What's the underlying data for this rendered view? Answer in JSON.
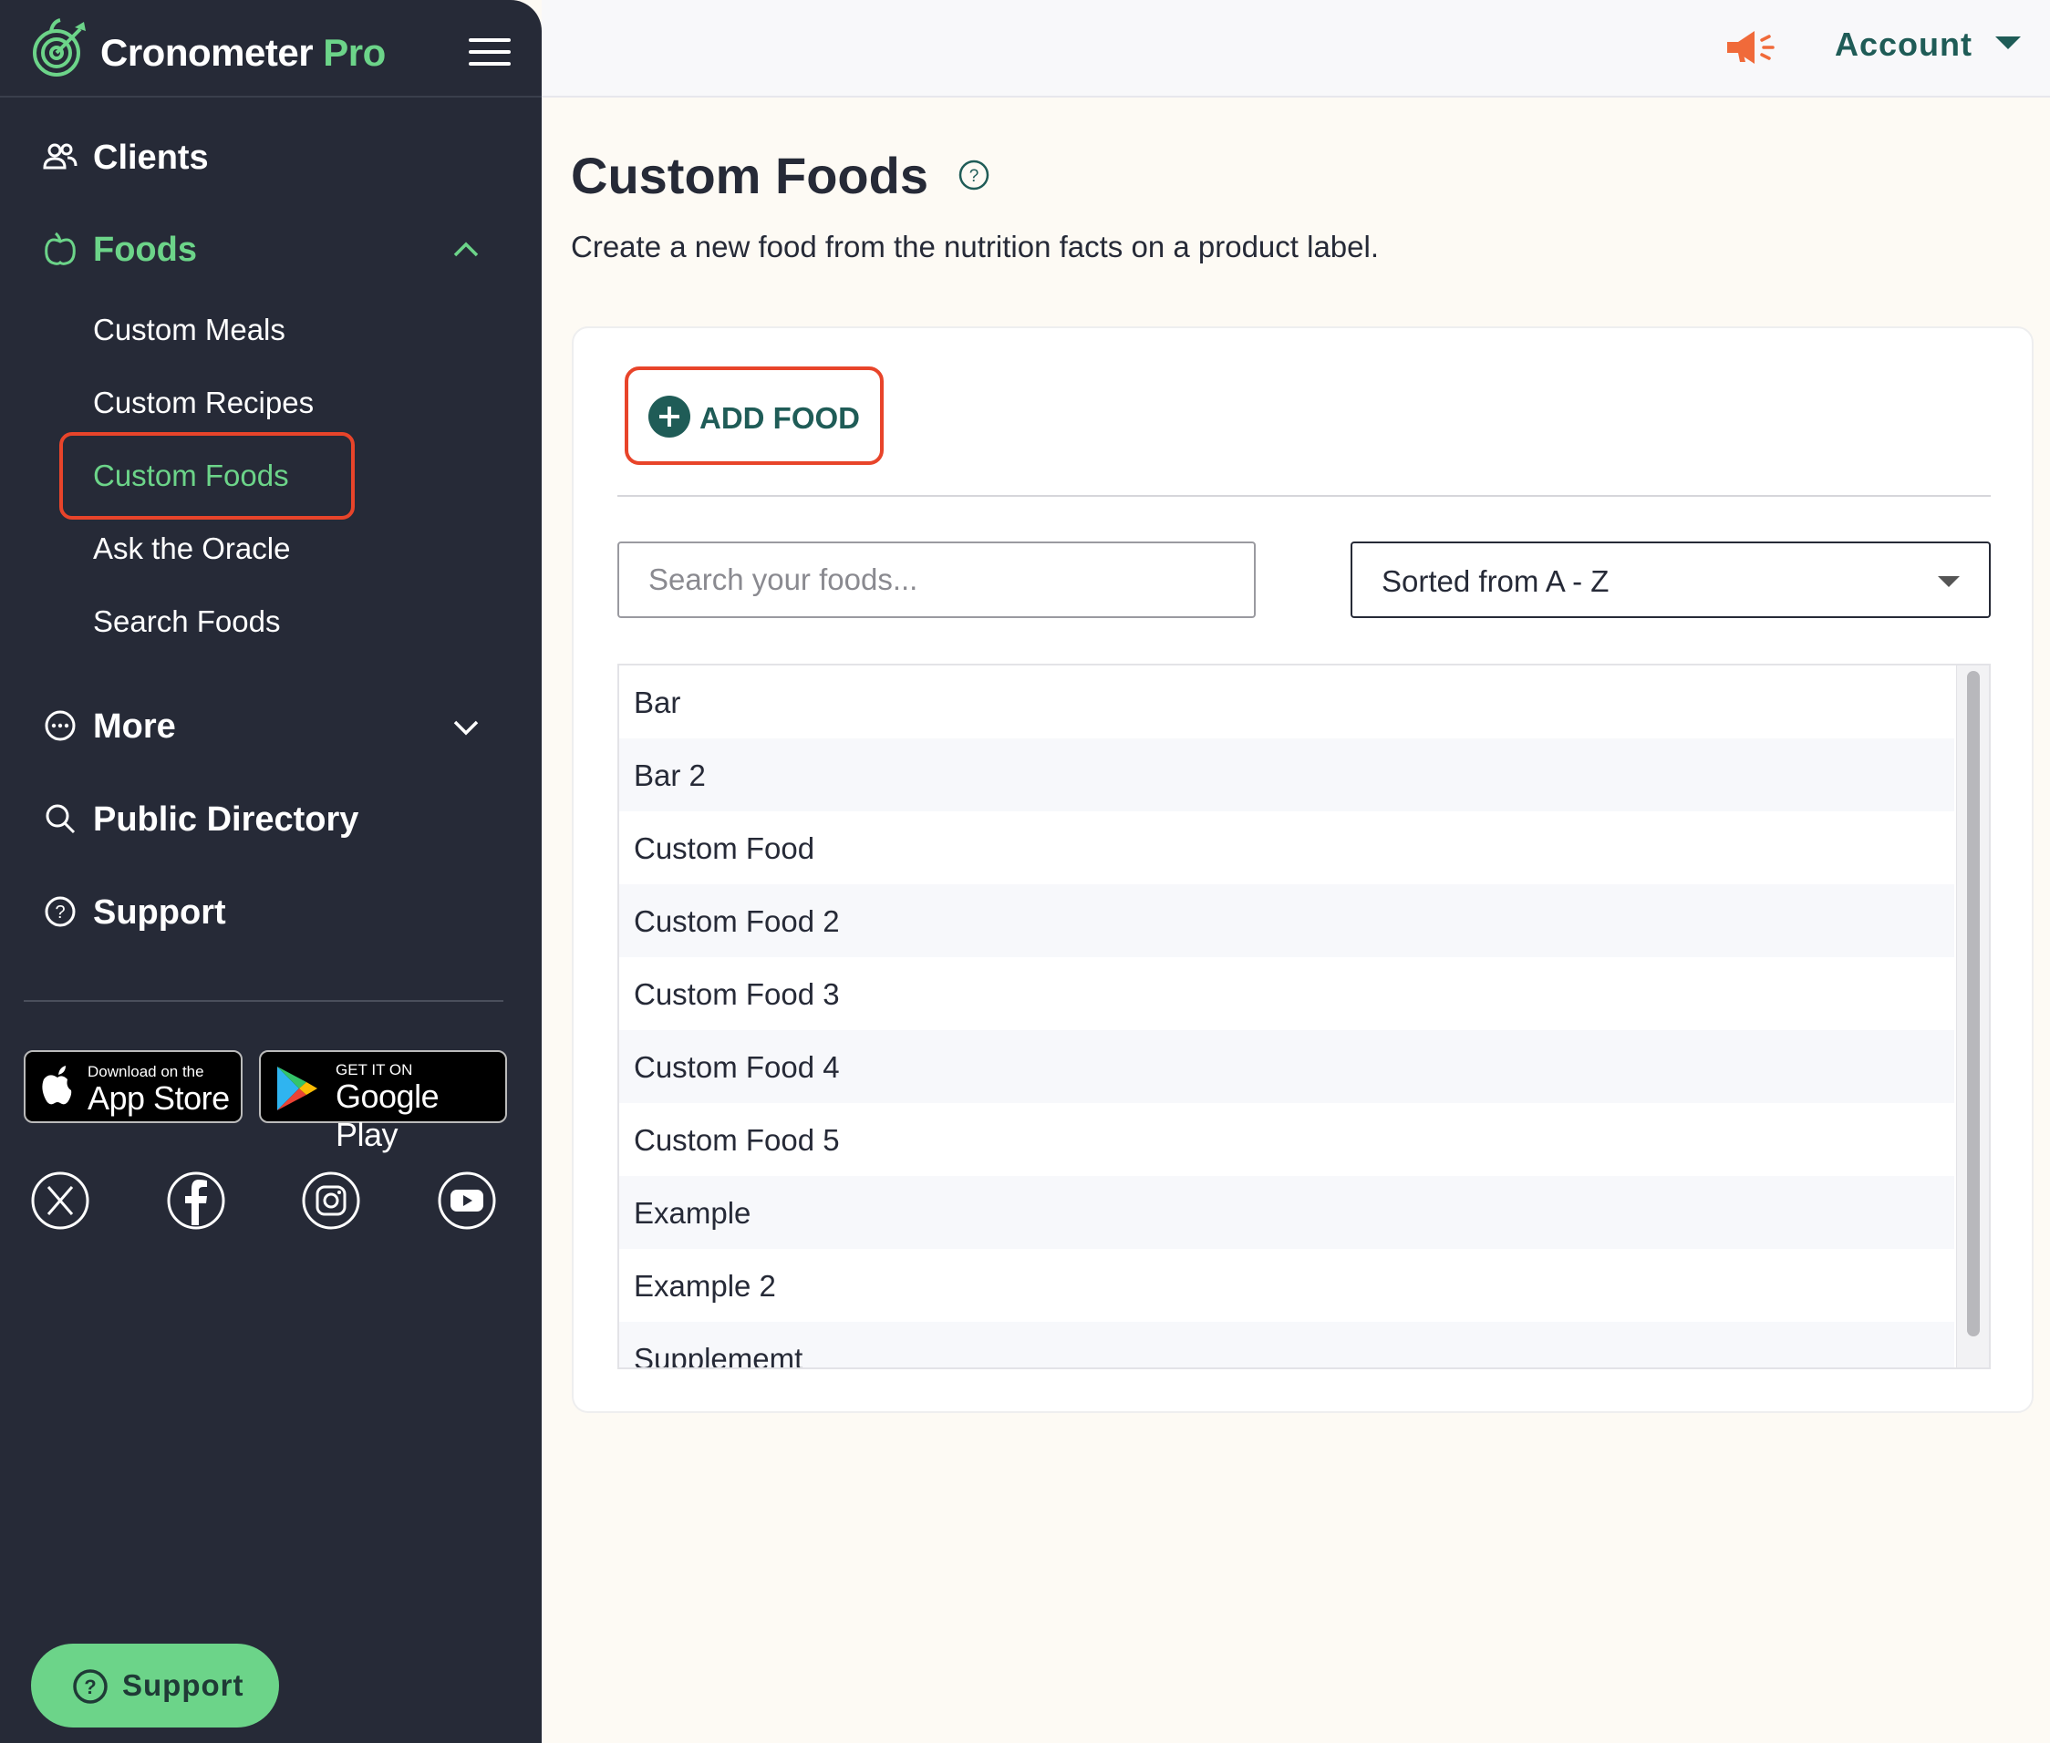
{
  "brand": {
    "name": "Cronometer",
    "suffix": "Pro"
  },
  "sidebar": {
    "clients": "Clients",
    "foods": "Foods",
    "foods_items": [
      "Custom Meals",
      "Custom Recipes",
      "Custom Foods",
      "Ask the Oracle",
      "Search Foods"
    ],
    "more": "More",
    "public_directory": "Public Directory",
    "support": "Support"
  },
  "stores": {
    "apple_small": "Download on the",
    "apple_big": "App Store",
    "google_small": "GET IT ON",
    "google_big": "Google Play"
  },
  "social_icons": [
    "x-icon",
    "facebook-icon",
    "instagram-icon",
    "youtube-icon"
  ],
  "support_button": "Support",
  "topbar": {
    "account": "Account"
  },
  "main": {
    "title": "Custom Foods",
    "subtitle": "Create a new food from the nutrition facts on a product label.",
    "add_food": "ADD FOOD",
    "search_placeholder": "Search your foods...",
    "sort": "Sorted from A - Z",
    "foods": [
      "Bar",
      "Bar 2",
      "Custom Food",
      "Custom Food 2",
      "Custom Food 3",
      "Custom Food 4",
      "Custom Food 5",
      "Example",
      "Example 2",
      "Supplememt"
    ]
  },
  "colors": {
    "accent_green": "#6cd489",
    "teal": "#1f5c57",
    "highlight_red": "#e8442a",
    "sidebar_bg": "#262a37"
  }
}
